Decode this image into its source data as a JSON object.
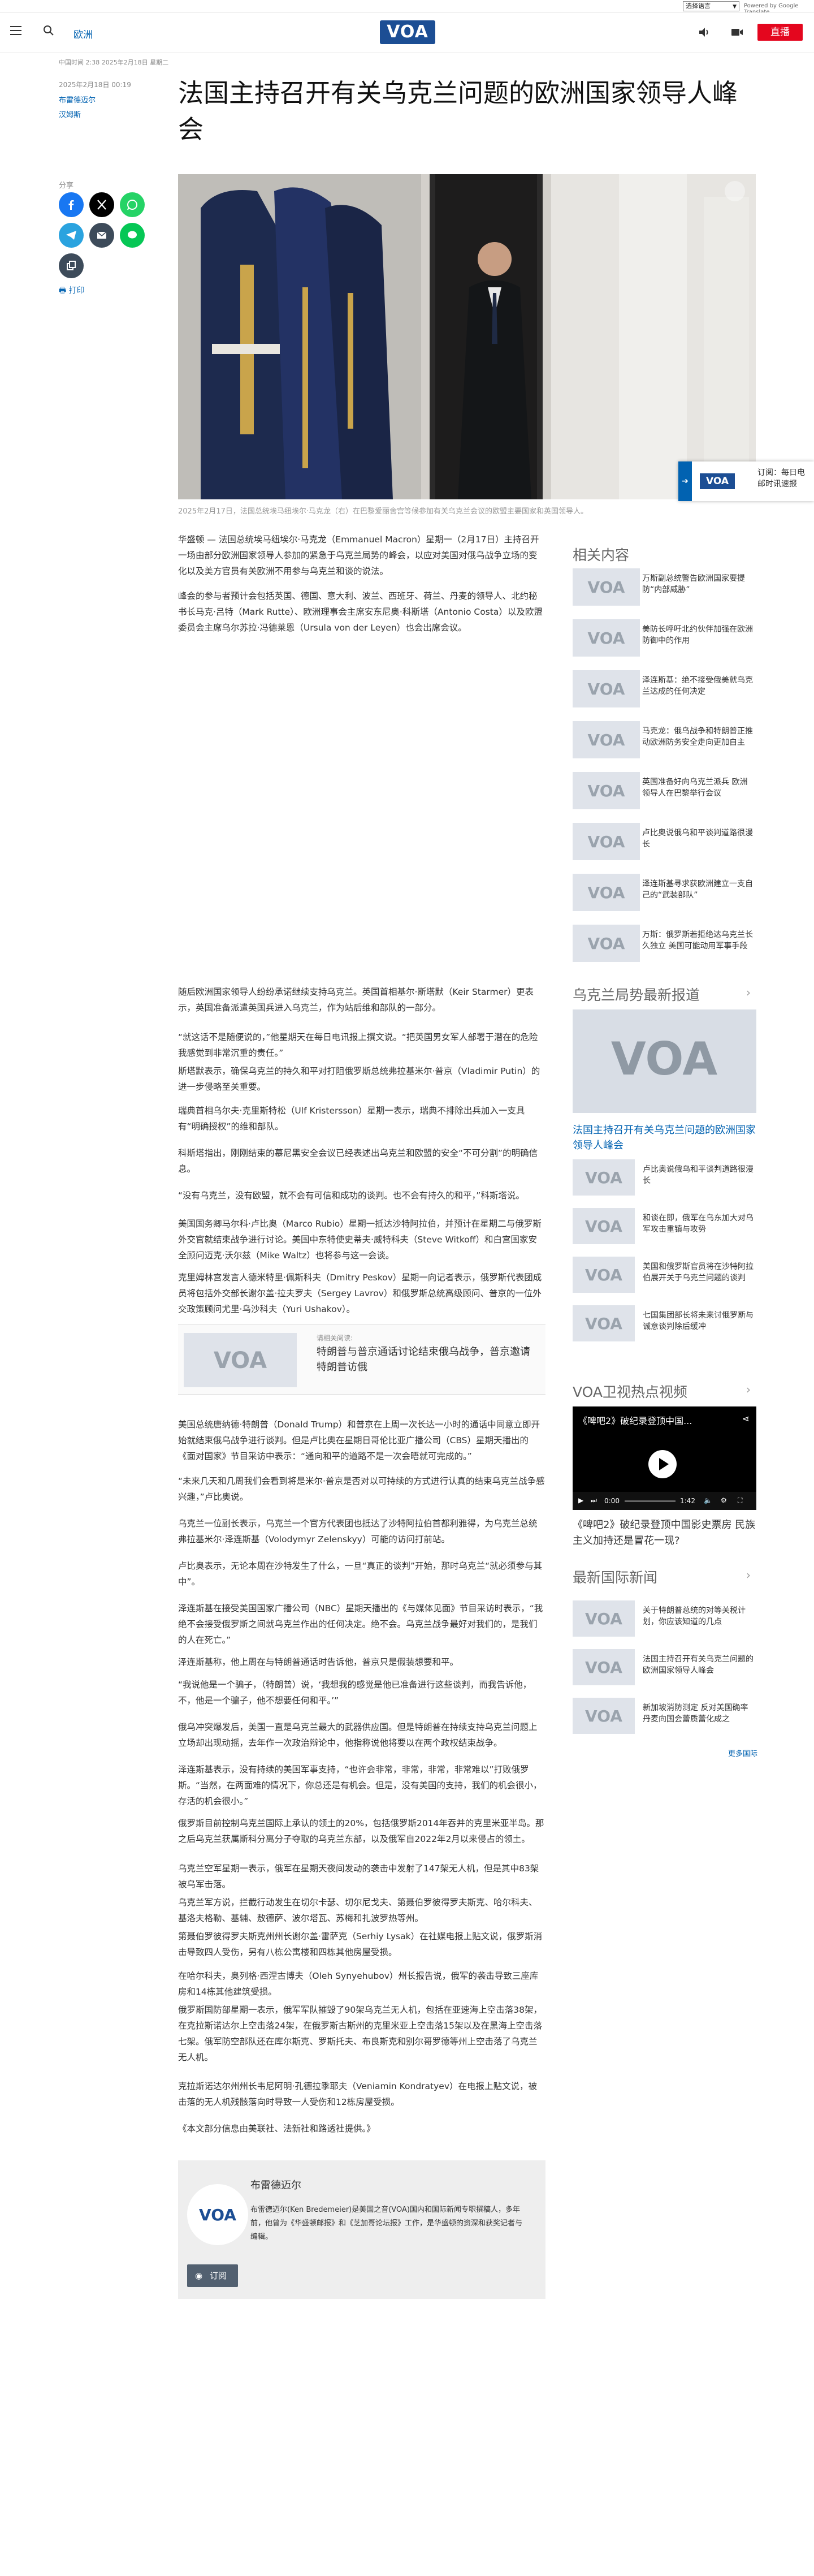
{
  "language_bar": {
    "select_label": "选择语言",
    "translate_label": "Powered by Google Translate"
  },
  "header": {
    "section_link": "欧洲",
    "logo_text": "VOA",
    "live_label": "直播"
  },
  "article": {
    "updated": "中国时间 2:38 2025年2月18日 星期二",
    "title": "法国主持召开有关乌克兰问题的欧洲国家领导人峰会",
    "published": "2025年2月18日 00:19",
    "authors": [
      "布雷德迈尔",
      "汉姆斯"
    ],
    "share_label": "分享",
    "print_label": "打印",
    "caption": "2025年2月17日，法国总统埃马纽埃尔·马克龙（右）在巴黎爱丽舍宫等候参加有关乌克兰会议的欧盟主要国家和英国领导人。",
    "paragraphs_top": [
      "华盛顿 — 法国总统埃马纽埃尔·马克龙（Emmanuel Macron）星期一（2月17日）主持召开一场由部分欧洲国家领导人参加的紧急于乌克兰局势的峰会，以应对美国对俄乌战争立场的变化以及美方官员有关欧洲不用参与乌克兰和谈的说法。",
      "峰会的参与者预计会包括英国、德国、意大利、波兰、西班牙、荷兰、丹麦的领导人、北约秘书长马克·吕特（Mark Rutte）、欧洲理事会主席安东尼奥·科斯塔（Antonio Costa）以及欧盟委员会主席乌尔苏拉·冯德莱恩（Ursula von der Leyen）也会出席会议。"
    ],
    "paragraphs_bottom": [
      "随后欧洲国家领导人纷纷承诺继续支持乌克兰。英国首相基尔·斯塔默（Keir Starmer）更表示，英国准备派遣英国兵进入乌克兰，作为站后维和部队的一部分。",
      "“就这话不是随便说的，”他星期天在每日电讯报上撰文说。“把英国男女军人部署于潜在的危险我感觉到非常沉重的责任。”",
      "斯塔默表示，确保乌克兰的持久和平对打阻俄罗斯总统弗拉基米尔·普京（Vladimir Putin）的进一步侵略至关重要。",
      "瑞典首相乌尔夫·克里斯特松（Ulf Kristersson）星期一表示，瑞典不排除出兵加入一支具有“明确授权”的维和部队。",
      "科斯塔指出，刚刚结束的慕尼黑安全会议已经表述出乌克兰和欧盟的安全“不可分割”的明确信息。",
      "“没有乌克兰，没有欧盟，就不会有可信和成功的谈判。也不会有持久的和平，”科斯塔说。",
      "美国国务卿马尔科·卢比奥（Marco Rubio）星期一抵达沙特阿拉伯，并预计在星期二与俄罗斯外交官就结束战争进行讨论。美国中东特使史蒂夫·威特科夫（Steve Witkoff）和白宫国家安全顾问迈克·沃尔兹（Mike Waltz）也将参与这一会谈。",
      "克里姆林宫发言人德米特里·佩斯科夫（Dmitry Peskov）星期一向记者表示，俄罗斯代表团成员将包括外交部长谢尔盖·拉夫罗夫（Sergey Lavrov）和俄罗斯总统高级顾问、普京的一位外交政策顾问尤里·乌沙科夫（Yuri Ushakov）。"
    ],
    "promo": {
      "kicker": "请相关阅读:",
      "title": "特朗普与普京通话讨论结束俄乌战争，普京邀请特朗普访俄"
    },
    "paragraphs_after_promo": [
      "美国总统唐纳德·特朗普（Donald Trump）和普京在上周一次长达一小时的通话中同意立即开始就结束俄乌战争进行谈判。但是卢比奥在星期日哥伦比亚广播公司（CBS）星期天播出的《面对国家》节目采访中表示：“通向和平的道路不是一次会晤就可完成的。”",
      "“未来几天和几周我们会看到将是米尔·普京是否对以可持续的方式进行认真的结束乌克兰战争感兴趣，”卢比奥说。",
      "乌克兰一位副长表示，乌克兰一个官方代表团也抵达了沙特阿拉伯首都利雅得，为乌克兰总统弗拉基米尔·泽连斯基（Volodymyr Zelenskyy）可能的访问打前站。",
      "卢比奥表示，无论本周在沙特发生了什么，一旦“真正的谈判”开始，那时乌克兰“就必须参与其中”。",
      "泽连斯基在接受美国国家广播公司（NBC）星期天播出的《与媒体见面》节目采访时表示，“我绝不会接受俄罗斯之间就乌克兰作出的任何决定。绝不会。乌克兰战争最好对我们的，是我们的人在死亡。”",
      "泽连斯基称，他上周在与特朗普通话时告诉他，普京只是假装想要和平。",
      "“我说他是一个骗子，（特朗普）说，‘我想我的感觉是他已准备进行这些谈判，而我告诉他，不，他是一个骗子，他不想要任何和平。’”",
      "俄乌冲突爆发后，美国一直是乌克兰最大的武器供应国。但是特朗普在持续支持乌克兰问题上立场却出现动摇，去年作一次政治辩论中，他指称说他将要以在两个政权结束战争。",
      "泽连斯基表示，没有持续的美国军事支持，“也许会非常，非常，非常，非常难以”打败俄罗斯。“当然，在两面难的情况下，你总还是有机会。但是，没有美国的支持，我们的机会很小，存活的机会很小。”",
      "俄罗斯目前控制乌克兰国际上承认的领土的20%，包括俄罗斯2014年吞并的克里米亚半岛。那之后乌克兰获属斯科分离分子夺取的乌克兰东部，以及俄军自2022年2月以来侵占的领土。",
      "乌克兰空军星期一表示，俄军在星期天夜间发动的袭击中发射了147架无人机，但是其中83架被乌军击落。",
      "乌克兰军方说，拦截行动发生在切尔卡瑟、切尔尼戈夫、第聂伯罗彼得罗夫斯克、哈尔科夫、基洛夫格勒、基辅、敖德萨、波尔塔瓦、苏梅和扎波罗热等州。",
      "第聂伯罗彼得罗夫斯克州州长谢尔盖·雷萨克（Serhiy Lysak）在社媒电报上贴文说，俄罗斯消击导致四人受伤，另有八栋公寓楼和四栋其他房屋受损。",
      "在哈尔科夫，奥列格·西涅古博夫（Oleh Synyehubov）州长报告说，俄军的袭击导致三座库房和14栋其他建筑受损。",
      "俄罗斯国防部星期一表示，俄军军队摧毁了90架乌克兰无人机，包括在亚速海上空击落38架，在克拉斯诺达尔上空击落24架，在俄罗斯古斯州的克里米亚上空击落15架以及在黑海上空击落七架。俄军防空部队还在库尔斯克、罗斯托夫、布良斯克和别尔哥罗德等州上空击落了乌克兰无人机。",
      "克拉斯诺达尔州州长韦尼阿明·孔德拉季耶夫（Veniamin Kondratyev）在电报上贴文说，被击落的无人机残骸落向时导致一人受伤和12栋房屋受损。",
      "《本文部分信息由美联社、法新社和路透社提供。》"
    ],
    "bio": {
      "name": "布雷德迈尔",
      "text": "布雷德迈尔(Ken Bredemeier)是美国之音(VOA)国内和国际新闻专职撰稿人，多年前，他曾为《华盛顿邮报》和《芝加哥论坛报》工作，是华盛顿的资深和获奖记者与编辑。",
      "rss_label": "订阅"
    }
  },
  "subscribe_widget": {
    "text": "订阅：每日电邮时讯速报"
  },
  "sidebar": {
    "related_heading": "相关内容",
    "related": [
      "万斯副总统警告欧洲国家要提防“内部威胁”",
      "美防长呼吁北约伙伴加强在欧洲防御中的作用",
      "泽连斯基：绝不接受俄美就乌克兰达成的任何决定",
      "马克龙：俄乌战争和特朗普正推动欧洲防务安全走向更加自主",
      "英国准备好向乌克兰派兵 欧洲领导人在巴黎举行会议",
      "卢比奥说俄乌和平谈判道路很漫长",
      "泽连斯基寻求获欧洲建立一支自己的“武装部队”",
      "万斯：俄罗斯若拒绝达乌克兰长久独立 美国可能动用军事手段"
    ],
    "ukraine_heading": "乌克兰局势最新报道",
    "ukraine_feature_title": "法国主持召开有关乌克兰问题的欧洲国家领导人峰会",
    "ukraine_list": [
      "卢比奥说俄乌和平谈判道路很漫长",
      "和谈在即，俄军在乌东加大对乌军攻击重镇与攻势",
      "美国和俄罗斯官员将在沙特阿拉伯展开关于乌克兰问题的谈判",
      "七国集团部长将未来讨俄罗斯与诚意谈判除后缓冲"
    ],
    "video_heading": "VOA卫视热点视频",
    "video_title": "《啤吧2》破纪录登顶中国...",
    "video_time_current": "0:00",
    "video_time_total": "1:42",
    "video_caption": "《啤吧2》破纪录登顶中国影史票房 民族主义加持还是冒花一现?",
    "intl_heading": "最新国际新闻",
    "intl_list": [
      "关于特朗普总统的对等关税计划，你应该知道的几点",
      "法国主持召开有关乌克兰问题的欧洲国家领导人峰会",
      "新加坡消防测定 反对美国确率丹麦向国会蕾质蕾化成之"
    ],
    "more_label": "更多国际"
  },
  "colors": {
    "brand_blue": "#1c4e94",
    "link_blue": "#0162b1",
    "live_red": "#e4061e"
  }
}
